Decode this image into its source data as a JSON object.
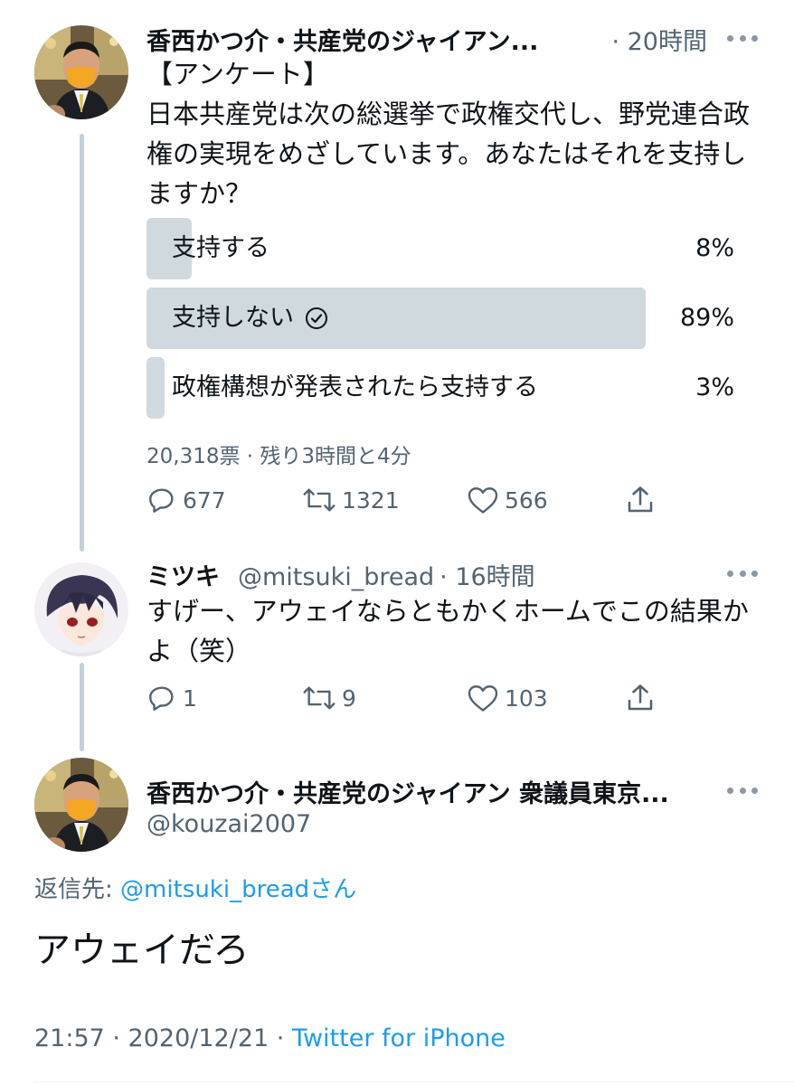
{
  "tweet1": {
    "display_name": "香西かつ介・共産党のジャイアン...",
    "time": "· 20時間",
    "text_lines": [
      "【アンケート】",
      "日本共産党は次の総選挙で政権交代し、野党連合政",
      "権の実現をめざしています。あなたはそれを支持し",
      "ますか？"
    ],
    "poll": {
      "options": [
        {
          "label": "支持する",
          "percent": "8%",
          "value": 8,
          "selected": false
        },
        {
          "label": "支持しない",
          "percent": "89%",
          "value": 89,
          "selected": true
        },
        {
          "label": "政権構想が発表されたら支持する",
          "percent": "3%",
          "value": 3,
          "selected": false
        }
      ],
      "votes": "20,318票 · 残り3時間と4分"
    },
    "actions": {
      "replies": "677",
      "retweets": "1321",
      "likes": "566"
    }
  },
  "tweet2": {
    "display_name": "ミツキ",
    "handle": "@mitsuki_bread",
    "time": "· 16時間",
    "text_lines": [
      "すげー、アウェイならともかくホームでこの結果か",
      "よ（笑）"
    ],
    "actions": {
      "replies": "1",
      "retweets": "9",
      "likes": "103"
    }
  },
  "tweet3": {
    "display_name": "香西かつ介・共産党のジャイアン 衆議員東京...",
    "handle": "@kouzai2007",
    "reply_prefix": "返信先: ",
    "reply_mention": "@mitsuki_bread",
    "reply_suffix": "さん",
    "text": "アウェイだろ",
    "timestamp": "21:57 · 2020/12/21 · ",
    "source": "Twitter for iPhone"
  },
  "colors": {
    "accent": "#1d9bf0",
    "muted": "#536471",
    "poll_bar": "#cfd9de",
    "mask": "#f5a623"
  }
}
